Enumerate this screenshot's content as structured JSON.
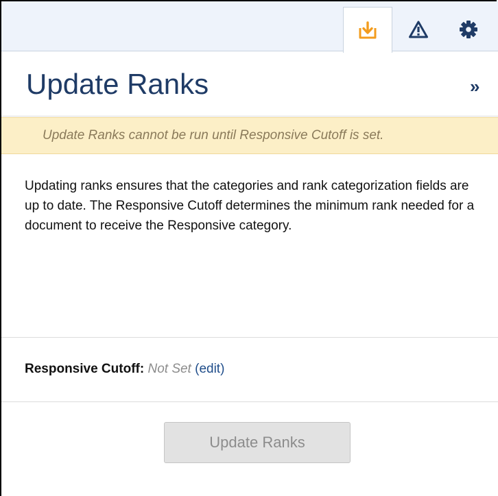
{
  "tabs": [
    {
      "icon": "download-tray-icon",
      "active": true
    },
    {
      "icon": "warning-triangle-icon",
      "active": false
    },
    {
      "icon": "gear-icon",
      "active": false
    }
  ],
  "header": {
    "title": "Update Ranks",
    "collapse_label": "»"
  },
  "warning": {
    "text": "Update Ranks cannot be run until Responsive Cutoff is set."
  },
  "description": "Updating ranks ensures that the categories and rank categorization fields are up to date. The Responsive Cutoff determines the minimum rank needed for a document to receive the Responsive category.",
  "cutoff": {
    "label": "Responsive Cutoff:",
    "value": "Not Set",
    "edit_label": "(edit)"
  },
  "action": {
    "button_label": "Update Ranks"
  },
  "colors": {
    "accent_orange": "#f39c1e",
    "title_navy": "#1f3b66",
    "warning_bg": "#fcefc7",
    "tabbar_bg": "#eef3fb"
  }
}
